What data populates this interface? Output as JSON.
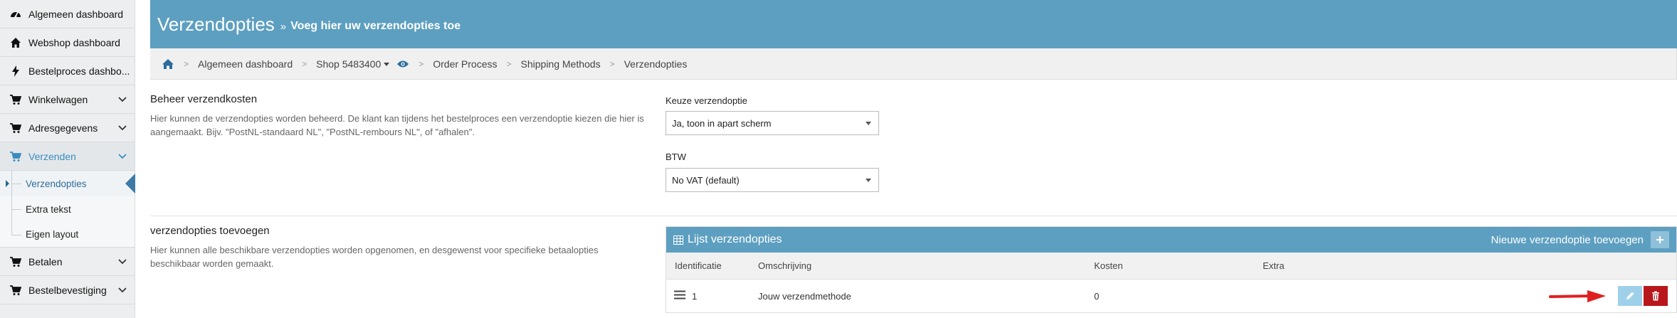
{
  "sidebar": {
    "items": [
      {
        "label": "Algemeen dashboard",
        "icon": "speedometer-icon"
      },
      {
        "label": "Webshop dashboard",
        "icon": "home-icon"
      },
      {
        "label": "Bestelproces dashbo...",
        "icon": "bolt-icon"
      },
      {
        "label": "Winkelwagen",
        "icon": "cart-icon"
      },
      {
        "label": "Adresgegevens",
        "icon": "cart-icon"
      },
      {
        "label": "Verzenden",
        "icon": "cart-icon"
      },
      {
        "label": "Betalen",
        "icon": "cart-icon"
      },
      {
        "label": "Bestelbevestiging",
        "icon": "cart-icon"
      }
    ],
    "subitems": [
      {
        "label": "Verzendopties"
      },
      {
        "label": "Extra tekst"
      },
      {
        "label": "Eigen layout"
      }
    ]
  },
  "header": {
    "title": "Verzendopties",
    "separator": "»",
    "subtitle": "Voeg hier uw verzendopties toe"
  },
  "breadcrumb": {
    "items": [
      "Algemeen dashboard",
      "Shop 5483400",
      "Order Process",
      "Shipping Methods",
      "Verzendopties"
    ]
  },
  "settings": {
    "title": "Beheer verzendkosten",
    "description": "Hier kunnen de verzendopties worden beheerd. De klant kan tijdens het bestelproces een verzendoptie kiezen die hier is aangemaakt. Bijv. \"PostNL-standaard NL\", \"PostNL-rembours NL\", of \"afhalen\".",
    "choice_label": "Keuze verzendoptie",
    "choice_value": "Ja, toon in apart scherm",
    "vat_label": "BTW",
    "vat_value": "No VAT (default)"
  },
  "add_section": {
    "title": "verzendopties toevoegen",
    "description": "Hier kunnen alle beschikbare verzendopties worden opgenomen, en desgewenst voor specifieke betaalopties beschikbaar worden gemaakt."
  },
  "list": {
    "title": "Lijst verzendopties",
    "new_label": "Nieuwe verzendoptie toevoegen",
    "columns": [
      "Identificatie",
      "Omschrijving",
      "Kosten",
      "Extra"
    ],
    "rows": [
      {
        "id": "1",
        "description": "Jouw verzendmethode",
        "cost": "0",
        "extra": ""
      }
    ]
  },
  "colors": {
    "header_bg": "#5d9fc0",
    "active_link": "#3a8cc0",
    "delete": "#b8171c",
    "edit": "#9fd0ea",
    "annotation_arrow": "#e02020"
  }
}
